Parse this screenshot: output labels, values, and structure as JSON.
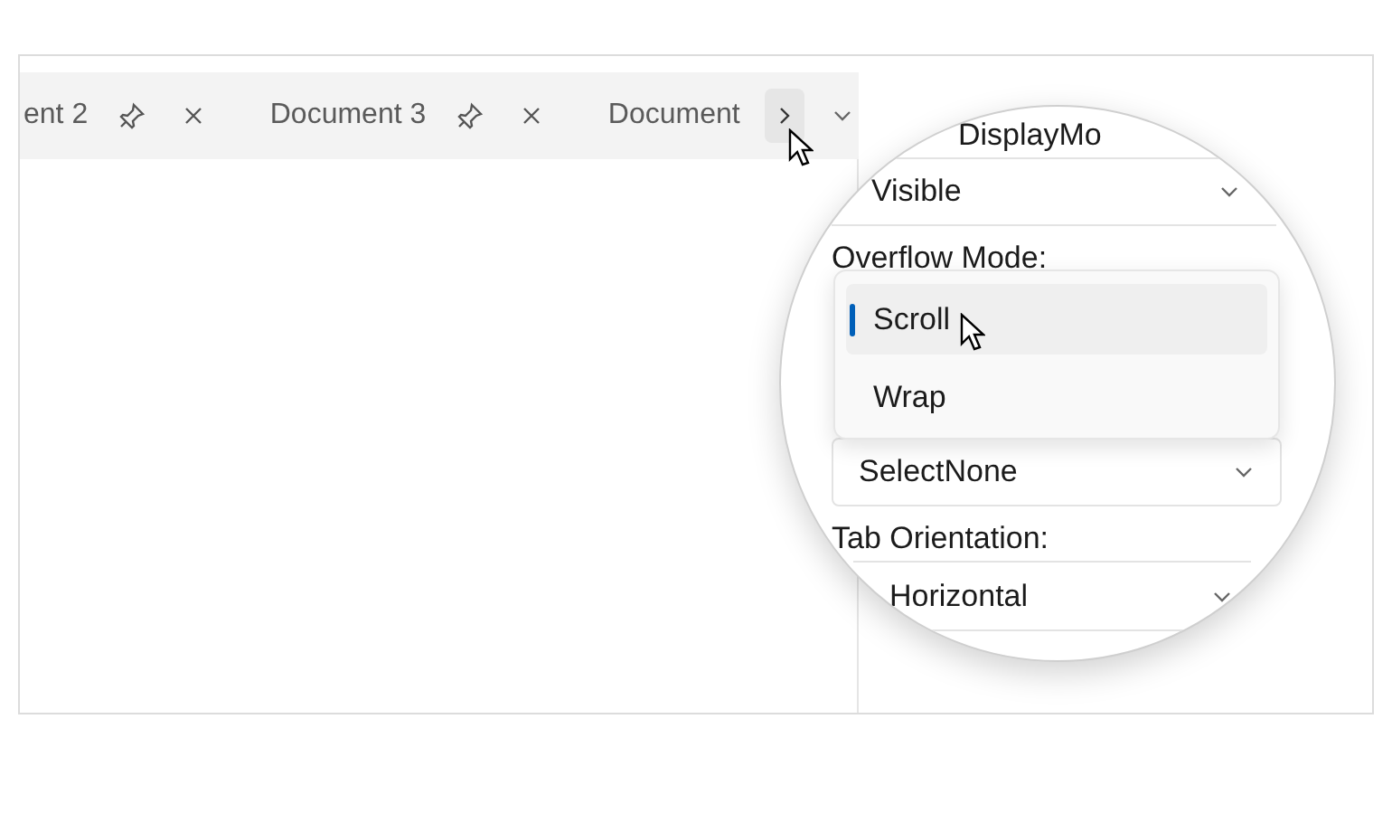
{
  "tabs": [
    {
      "label": "ent 2"
    },
    {
      "label": "Document 3"
    },
    {
      "label": "Document"
    }
  ],
  "magnifier": {
    "top_label": "DisplayMo",
    "display_value": "Visible",
    "overflow_label": "Overflow Mode:",
    "overflow_options": [
      {
        "label": "Scroll",
        "selected": true
      },
      {
        "label": "Wrap",
        "selected": false
      }
    ],
    "selection_value": "SelectNone",
    "orientation_label": "Tab Orientation:",
    "orientation_value": "Horizontal"
  }
}
